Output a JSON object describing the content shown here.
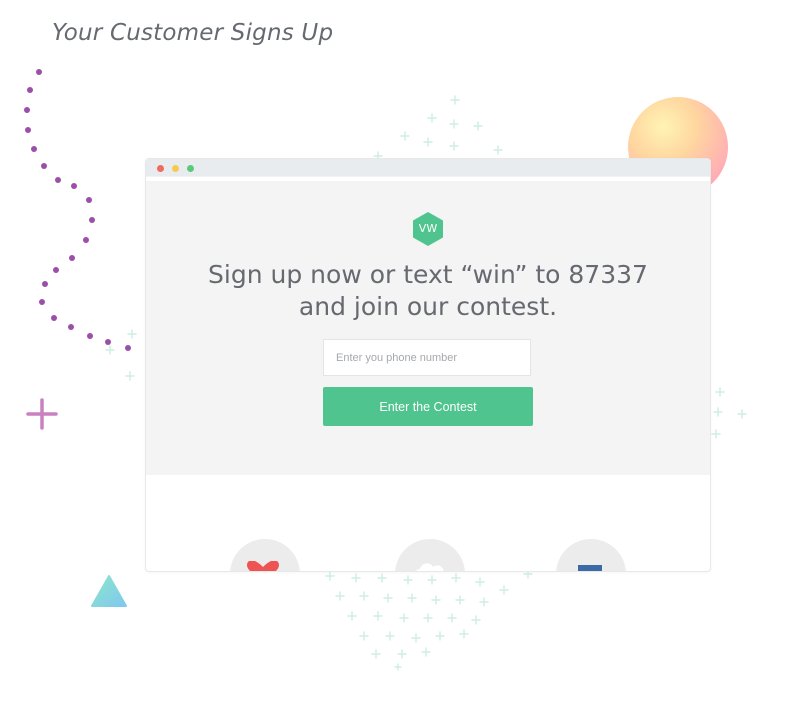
{
  "page": {
    "heading": "Your Customer Signs Up"
  },
  "browser": {
    "dots": [
      "red",
      "yellow",
      "green"
    ],
    "logo_text": "VW",
    "headline": "Sign up now or text “win” to 87337 and join our contest.",
    "phone_placeholder": "Enter you phone number",
    "cta_label": "Enter the Contest"
  },
  "colors": {
    "accent": "#4fc48f",
    "dotted_path": "#9b4fa8",
    "headline": "#666a70",
    "hero_bg": "#f4f4f4"
  },
  "icons": [
    "heart-icon",
    "cloud-icon",
    "facebook-icon",
    "triangle-icon",
    "plus-icon",
    "sun-circle"
  ]
}
